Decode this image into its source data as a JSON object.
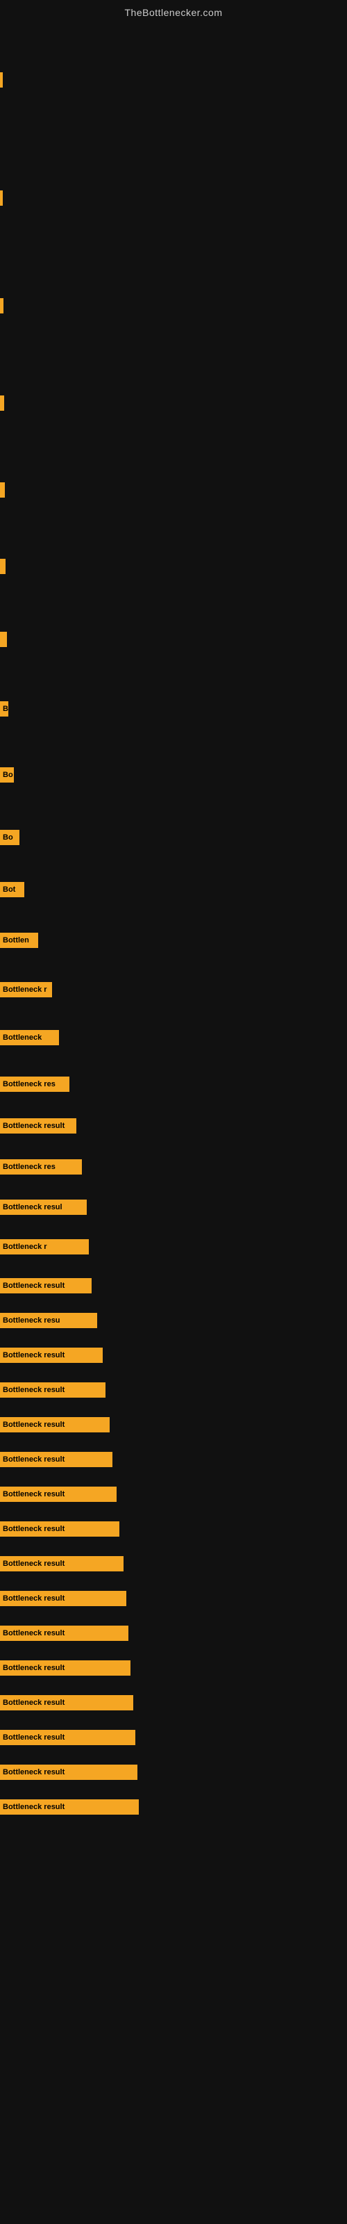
{
  "site": {
    "title": "TheBottlenecker.com"
  },
  "bars": [
    {
      "id": 1,
      "widthClass": "bar-w1",
      "label": ""
    },
    {
      "id": 2,
      "widthClass": "bar-w2",
      "label": ""
    },
    {
      "id": 3,
      "widthClass": "bar-w3",
      "label": ""
    },
    {
      "id": 4,
      "widthClass": "bar-w4",
      "label": ""
    },
    {
      "id": 5,
      "widthClass": "bar-w5",
      "label": ""
    },
    {
      "id": 6,
      "widthClass": "bar-w6",
      "label": ""
    },
    {
      "id": 7,
      "widthClass": "bar-w7",
      "label": ""
    },
    {
      "id": 8,
      "widthClass": "bar-w8",
      "label": "B"
    },
    {
      "id": 9,
      "widthClass": "bar-w9",
      "label": "Bo"
    },
    {
      "id": 10,
      "widthClass": "bar-w10",
      "label": "Bo"
    },
    {
      "id": 11,
      "widthClass": "bar-w11",
      "label": "Bot"
    },
    {
      "id": 12,
      "widthClass": "bar-w12",
      "label": "Bottlen"
    },
    {
      "id": 13,
      "widthClass": "bar-w13",
      "label": "Bottleneck r"
    },
    {
      "id": 14,
      "widthClass": "bar-w14",
      "label": "Bottleneck"
    },
    {
      "id": 15,
      "widthClass": "bar-w15",
      "label": "Bottleneck res"
    },
    {
      "id": 16,
      "widthClass": "bar-w16",
      "label": "Bottleneck result"
    },
    {
      "id": 17,
      "widthClass": "bar-w17",
      "label": "Bottleneck res"
    },
    {
      "id": 18,
      "widthClass": "bar-w18",
      "label": "Bottleneck resul"
    },
    {
      "id": 19,
      "widthClass": "bar-w19",
      "label": "Bottleneck r"
    },
    {
      "id": 20,
      "widthClass": "bar-w20",
      "label": "Bottleneck result"
    },
    {
      "id": 21,
      "widthClass": "bar-w21",
      "label": "Bottleneck resu"
    },
    {
      "id": 22,
      "widthClass": "bar-w22",
      "label": "Bottleneck result"
    },
    {
      "id": 23,
      "widthClass": "bar-w23",
      "label": "Bottleneck result"
    },
    {
      "id": 24,
      "widthClass": "bar-w24",
      "label": "Bottleneck result"
    },
    {
      "id": 25,
      "widthClass": "bar-w25",
      "label": "Bottleneck result"
    },
    {
      "id": 26,
      "widthClass": "bar-w26",
      "label": "Bottleneck result"
    },
    {
      "id": 27,
      "widthClass": "bar-w27",
      "label": "Bottleneck result"
    },
    {
      "id": 28,
      "widthClass": "bar-w28",
      "label": "Bottleneck result"
    },
    {
      "id": 29,
      "widthClass": "bar-w29",
      "label": "Bottleneck result"
    },
    {
      "id": 30,
      "widthClass": "bar-w30",
      "label": "Bottleneck result"
    },
    {
      "id": 31,
      "widthClass": "bar-w31",
      "label": "Bottleneck result"
    },
    {
      "id": 32,
      "widthClass": "bar-w32",
      "label": "Bottleneck result"
    },
    {
      "id": 33,
      "widthClass": "bar-w33",
      "label": "Bottleneck result"
    },
    {
      "id": 34,
      "widthClass": "bar-w34",
      "label": "Bottleneck result"
    },
    {
      "id": 35,
      "widthClass": "bar-w35",
      "label": "Bottleneck result"
    }
  ]
}
